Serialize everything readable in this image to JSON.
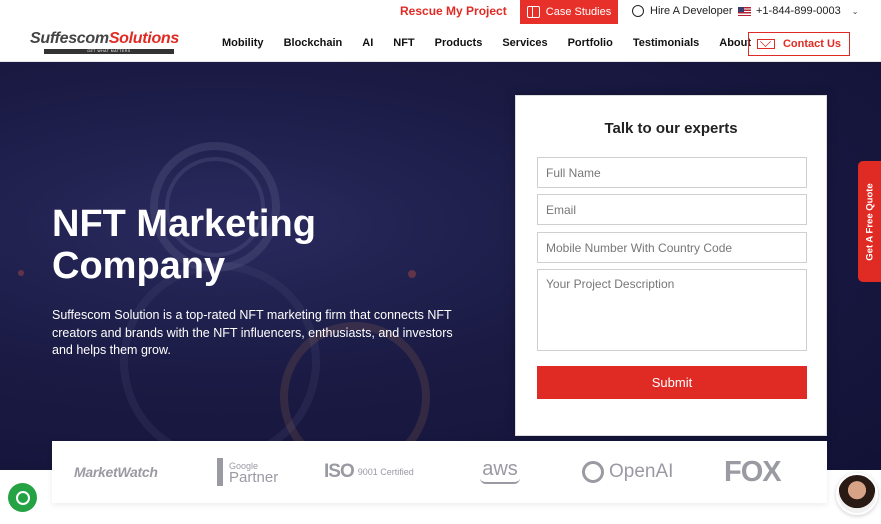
{
  "topbar": {
    "rescue": "Rescue My Project",
    "case_studies": "Case Studies",
    "hire": "Hire A Developer",
    "phone": "+1-844-899-0003"
  },
  "nav": {
    "logo_main": "Suffescom",
    "logo_accent": "Solutions",
    "logo_tagline": "GET WHAT MATTERS",
    "items": [
      "Mobility",
      "Blockchain",
      "AI",
      "NFT",
      "Products",
      "Services",
      "Portfolio",
      "Testimonials",
      "About"
    ],
    "contact": "Contact Us"
  },
  "hero": {
    "title": "NFT Marketing Company",
    "description": "Suffescom Solution is a top-rated NFT marketing firm that connects NFT creators and brands with the NFT influencers, enthusiasts, and investors and helps them grow."
  },
  "form": {
    "title": "Talk to our experts",
    "name_placeholder": "Full Name",
    "email_placeholder": "Email",
    "mobile_placeholder": "Mobile Number With Country Code",
    "desc_placeholder": "Your Project Description",
    "submit": "Submit"
  },
  "quote_tab": "Get A Free Quote",
  "logos": {
    "marketwatch": "MarketWatch",
    "google_small": "Google",
    "google_big": "Partner",
    "iso": "ISO",
    "iso_sub": "9001 Certified",
    "aws": "aws",
    "openai": "OpenAI",
    "fox": "FOX"
  },
  "colors": {
    "accent": "#e02b24",
    "hero_bg": "#1a1a44",
    "whatsapp": "#25a244"
  }
}
